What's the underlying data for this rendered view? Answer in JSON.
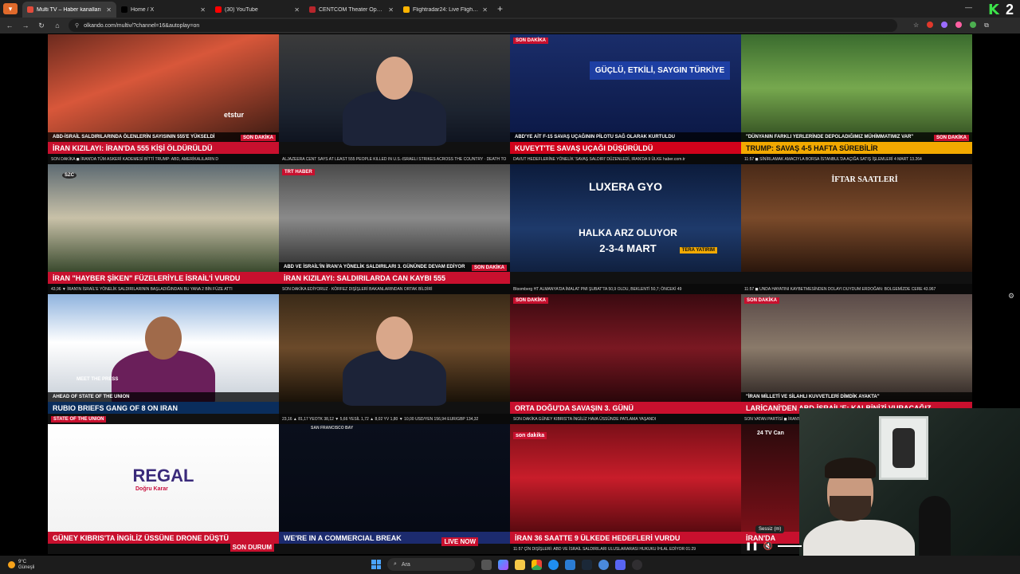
{
  "browser": {
    "tabs": [
      {
        "label": "Multi TV – Haber kanalları",
        "color": "#e34b3b",
        "active": true
      },
      {
        "label": "Home / X",
        "color": "#000000",
        "active": false
      },
      {
        "label": "(30) YouTube",
        "color": "#ff0000",
        "active": false
      },
      {
        "label": "CENTCOM Theater Operations",
        "color": "#b8262c",
        "active": false
      },
      {
        "label": "Flightradar24: Live Flight Tracker",
        "color": "#ffb400",
        "active": false
      }
    ],
    "url": "olkando.com/multiv/?channel=16&autoplay=on",
    "new_tab": "+",
    "logo_letter": "K",
    "logo_number": "2"
  },
  "channels": [
    {
      "top": "",
      "band1": "İRAN KIZILAYI: İRAN'DA 555 KİŞİ ÖLDÜRÜLDÜ",
      "band2": "ABD-İSRAİL SALDIRILARINDA ÖLENLERİN SAYISININ 555'E YÜKSELDİ",
      "ticker": "SON DAKİKA  ◼  İRAN'DA TÜM ASKERİ KADEMESİ BİTTİ  TRUMP: ABD, AMERİKALILARIN D",
      "tag": "SON DAKİKA",
      "bug": "etstur",
      "band_color": "#c8102e"
    },
    {
      "top": "",
      "band1": "",
      "band2": "",
      "ticker": "ALJAZEERA  CENT SAYS AT LEAST 555 PEOPLE KILLED IN U.S.-ISRAELI STRIKES ACROSS THE COUNTRY · DEATH TO",
      "tag": "",
      "bug": "",
      "band_color": "#b8870b"
    },
    {
      "top": "GÜÇLÜ, ETKİLİ, SAYGIN TÜRKİYE",
      "band1": "KUVEYT'TE SAVAŞ UÇAĞI DÜŞÜRÜLDÜ",
      "band2": "ABD'YE AİT F-15 SAVAŞ UÇAĞININ PİLOTU SAĞ OLARAK KURTULDU",
      "ticker": "DAVUT HEDEFLERİNE YÖNELİK 'SAVAŞ SALDIRI' DÜZENLEDİ, IRAN'DA 9 ÜLKE  haber.com.tr",
      "tag": "SON DAKİKA",
      "bug": "",
      "band_color": "#d0021b"
    },
    {
      "top": "",
      "band1": "TRUMP: SAVAŞ 4-5 HAFTA SÜREBİLİR",
      "band2": "\"DÜNYANIN FARKLI YERLERİNDE DEPOLADIĞIMIZ MÜHİMMATIMIZ VAR\"",
      "ticker": "11:57 ◼ SİNİRLAMAK AMACIYLA BORSA İSTANBUL'DA AÇIĞA SATIŞ İŞLEMLERİ 4 MART  13.264",
      "tag": "SON DAKİKA",
      "bug": "",
      "band_color": "#f2a900"
    },
    {
      "top": "",
      "band1": "İRAN \"HAYBER ŞİKEN\" FÜZELERİYLE İSRAİL'İ VURDU",
      "band2": "",
      "ticker": "43,96 ▼  İRAN'IN İSRAİL'E YÖNELİK SALDIRILARININ BAŞLADIĞINDAN BU YANA 2 BİN FÜZE ATTI",
      "tag": "SZC",
      "bug": "",
      "band_color": "#c8102e"
    },
    {
      "top": "TRT HABER",
      "band1": "İRAN KIZILAYI: SALDIRILARDA CAN KAYBI 555",
      "band2": "ABD VE İSRAİL'İN İRAN'A YÖNELİK SALDIRILARI 3. GÜNÜNDE DEVAM EDİYOR",
      "ticker": "SON DAKİKA  EDİYORUZ ·  KÖRFEZ DIŞİŞLERİ BAKANLARINDAN ORTAK BİLDİRİ",
      "tag": "SON DAKİKA",
      "bug": "",
      "band_color": "#c8102e"
    },
    {
      "top": "LUXERA GYO",
      "band1": "HALKA ARZ OLUYOR",
      "band2": "2-3-4 MART",
      "ticker": "Bloomberg HT  ALMANYA'DA İMALAT PMI ŞUBAT'TA 50,9 OLDU, BEKLENTİ 50,7; ÖNCEKİ 49",
      "tag": "TERA YATIRIM",
      "bug": "",
      "band_color": "#1a3c73"
    },
    {
      "top": "İFTAR SAATLERİ",
      "band1": "",
      "band2": "",
      "ticker": "11:57 ◼ UNDA HAYATINI KAYBETMESİNDEN DOLAYI DUYDUM  ERDOĞAN: BOLGEMİZDE CERE  43.967",
      "tag": "",
      "bug": "",
      "band_color": "#3a2418"
    },
    {
      "top": "",
      "band1": "RUBIO BRIEFS GANG OF 8 ON IRAN",
      "band2": "AHEAD OF STATE OF THE UNION",
      "ticker": "",
      "tag": "STATE OF THE UNION",
      "bug": "MEET THE PRESS",
      "band_color": "#0a2d5c"
    },
    {
      "top": "",
      "band1": "",
      "band2": "",
      "ticker": "23,16 ▲ 81,17  YEOTK 38,12 ▼ 5,66  YESİL 1,72 ▲ 8,02  YV 1,80 ▼ 10,00  USD/YEN 156,94  EUR/GBP 134,32",
      "tag": "",
      "bug": "",
      "band_color": "#111111"
    },
    {
      "top": "",
      "band1": "ORTA DOĞU'DA SAVAŞIN 3. GÜNÜ",
      "band2": "",
      "ticker": "SON DAKİKA  GÜNEY KIBRIS'TA İNGİLİZ HAVA ÜSSÜNDE PATLAMA YAŞANDI",
      "tag": "SON DAKİKA",
      "bug": "",
      "band_color": "#c8102e"
    },
    {
      "top": "",
      "band1": "LARİCANİ'DEN ABD-İSRAİL'E: KALBİNİZİ VURACAĞIZ",
      "band2": "\"İRAN MİLLETİ VE SİLAHLI KUVVETLERİ DİMDİK AYAKTA\"",
      "ticker": "SON VATAN PARTİSİ ◼ İRAN'DA",
      "tag": "SON DAKİKA",
      "bug": "",
      "band_color": "#c8102e"
    },
    {
      "top": "REGAL",
      "band1": "GÜNEY KIBRIS'TA İNGİLİZ ÜSSÜNE DRONE DÜŞTÜ",
      "band2": "",
      "ticker": "",
      "tag": "SON DURUM",
      "bug": "Doğru Karar",
      "band_color": "#c8102e"
    },
    {
      "top": "SAN FRANCISCO BAY",
      "band1": "WE'RE IN A COMMERCIAL BREAK",
      "band2": "",
      "ticker": "",
      "tag": "LIVE NOW",
      "bug": "",
      "band_color": "#1c2b6e"
    },
    {
      "top": "",
      "band1": "İRAN 36 SAATTE 9 ÜLKEDE HEDEFLERİ VURDU",
      "band2": "",
      "ticker": "11:57  ÇİN DIŞİŞLERİ: ABD VE İSRAİL SALDIRILARI ULUSLARARASI HUKUKU İHLAL EDİYOR  01:29",
      "tag": "son dakika",
      "bug": "",
      "band_color": "#c8102e"
    },
    {
      "top": "24 TV Can",
      "band1": "İRAN'DA",
      "band2": "",
      "ticker": "",
      "tag": "",
      "bug": "",
      "band_color": "#c8102e"
    }
  ],
  "video_controls": {
    "mute_tooltip": "Sessiz (m)",
    "pause_icon": "❚❚"
  },
  "taskbar": {
    "weather_temp": "9°C",
    "weather_desc": "Güneşli",
    "search_placeholder": "Ara"
  }
}
